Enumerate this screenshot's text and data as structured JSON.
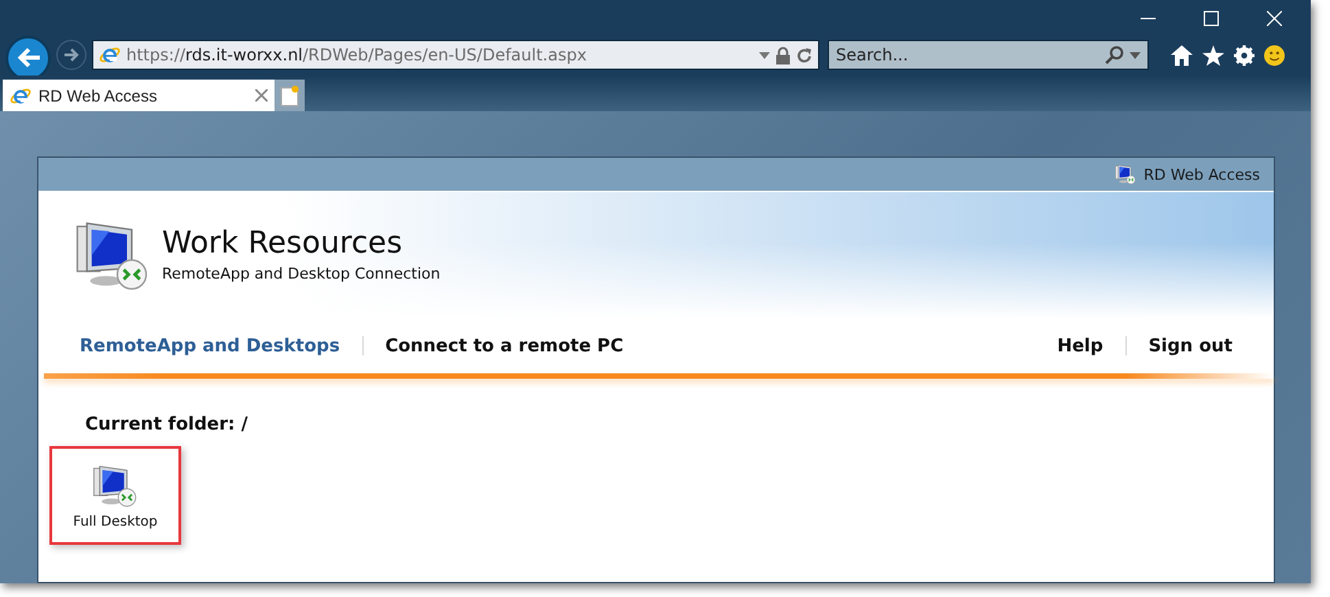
{
  "browser": {
    "address": {
      "scheme": "https://",
      "host": "rds.it-worxx.nl",
      "path": "/RDWeb/Pages/en-US/Default.aspx"
    },
    "search": {
      "placeholder": "Search..."
    },
    "tabs": [
      {
        "label": "RD Web Access",
        "selected": true
      }
    ]
  },
  "page": {
    "top_bar": {
      "label": "RD Web Access"
    },
    "title": "Work Resources",
    "subtitle": "RemoteApp and Desktop Connection",
    "nav": [
      {
        "label": "RemoteApp and Desktops",
        "selected": true
      },
      {
        "label": "Connect to a remote PC",
        "selected": false
      }
    ],
    "nav_right": [
      {
        "label": "Help"
      },
      {
        "label": "Sign out"
      }
    ],
    "current_folder": "Current folder: /",
    "items": [
      {
        "label": "Full Desktop",
        "selected": true
      }
    ]
  }
}
